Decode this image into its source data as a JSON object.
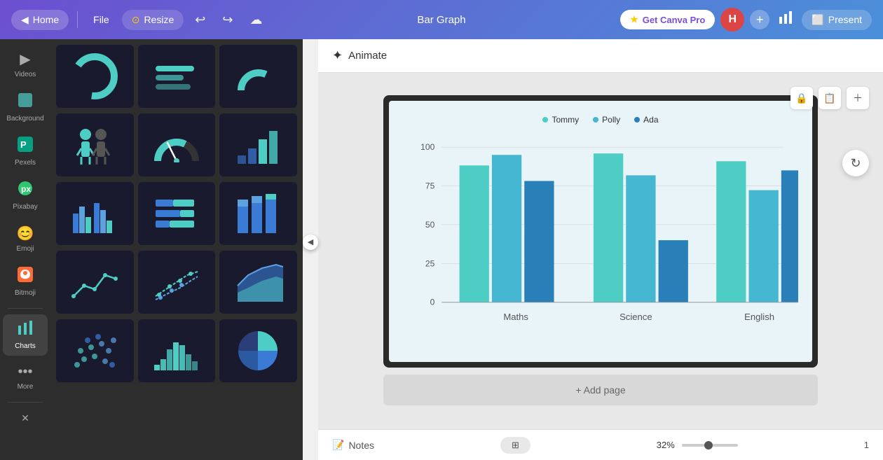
{
  "navbar": {
    "home_label": "Home",
    "file_label": "File",
    "resize_label": "Resize",
    "title": "Bar Graph",
    "canva_pro_label": "Get Canva Pro",
    "avatar_letter": "H",
    "present_label": "Present"
  },
  "animate": {
    "label": "Animate"
  },
  "chart": {
    "title": "Bar Graph",
    "legend": [
      {
        "name": "Tommy",
        "color": "#4ecdc4"
      },
      {
        "name": "Polly",
        "color": "#45b7d1"
      },
      {
        "name": "Ada",
        "color": "#2980b9"
      }
    ],
    "y_labels": [
      "100",
      "75",
      "50",
      "25",
      "0"
    ],
    "x_labels": [
      "Maths",
      "Science",
      "English"
    ],
    "groups": [
      {
        "label": "Maths",
        "bars": [
          {
            "series": "Tommy",
            "value": 88,
            "color": "#4ecdc4"
          },
          {
            "series": "Polly",
            "value": 95,
            "color": "#45b7d1"
          },
          {
            "series": "Ada",
            "value": 78,
            "color": "#2980b9"
          }
        ]
      },
      {
        "label": "Science",
        "bars": [
          {
            "series": "Tommy",
            "value": 96,
            "color": "#4ecdc4"
          },
          {
            "series": "Polly",
            "value": 82,
            "color": "#45b7d1"
          },
          {
            "series": "Ada",
            "value": 40,
            "color": "#2980b9"
          }
        ]
      },
      {
        "label": "English",
        "bars": [
          {
            "series": "Tommy",
            "value": 91,
            "color": "#4ecdc4"
          },
          {
            "series": "Polly",
            "value": 72,
            "color": "#45b7d1"
          },
          {
            "series": "Ada",
            "value": 85,
            "color": "#2980b9"
          }
        ]
      }
    ]
  },
  "sidebar": {
    "items": [
      {
        "label": "Videos",
        "icon": "▶"
      },
      {
        "label": "Background",
        "icon": "⬛"
      },
      {
        "label": "Pexels",
        "icon": "🅿"
      },
      {
        "label": "Pixabay",
        "icon": "🖼"
      },
      {
        "label": "Emoji",
        "icon": "😊"
      },
      {
        "label": "Bitmoji",
        "icon": "🤖"
      },
      {
        "label": "Charts",
        "icon": "📊"
      },
      {
        "label": "More",
        "icon": "•••"
      }
    ]
  },
  "bottom": {
    "notes_label": "Notes",
    "zoom_label": "32%",
    "page_label": "1"
  },
  "add_page": {
    "label": "+ Add page"
  },
  "canvas_tools": [
    "🔒",
    "📋",
    "➕"
  ]
}
